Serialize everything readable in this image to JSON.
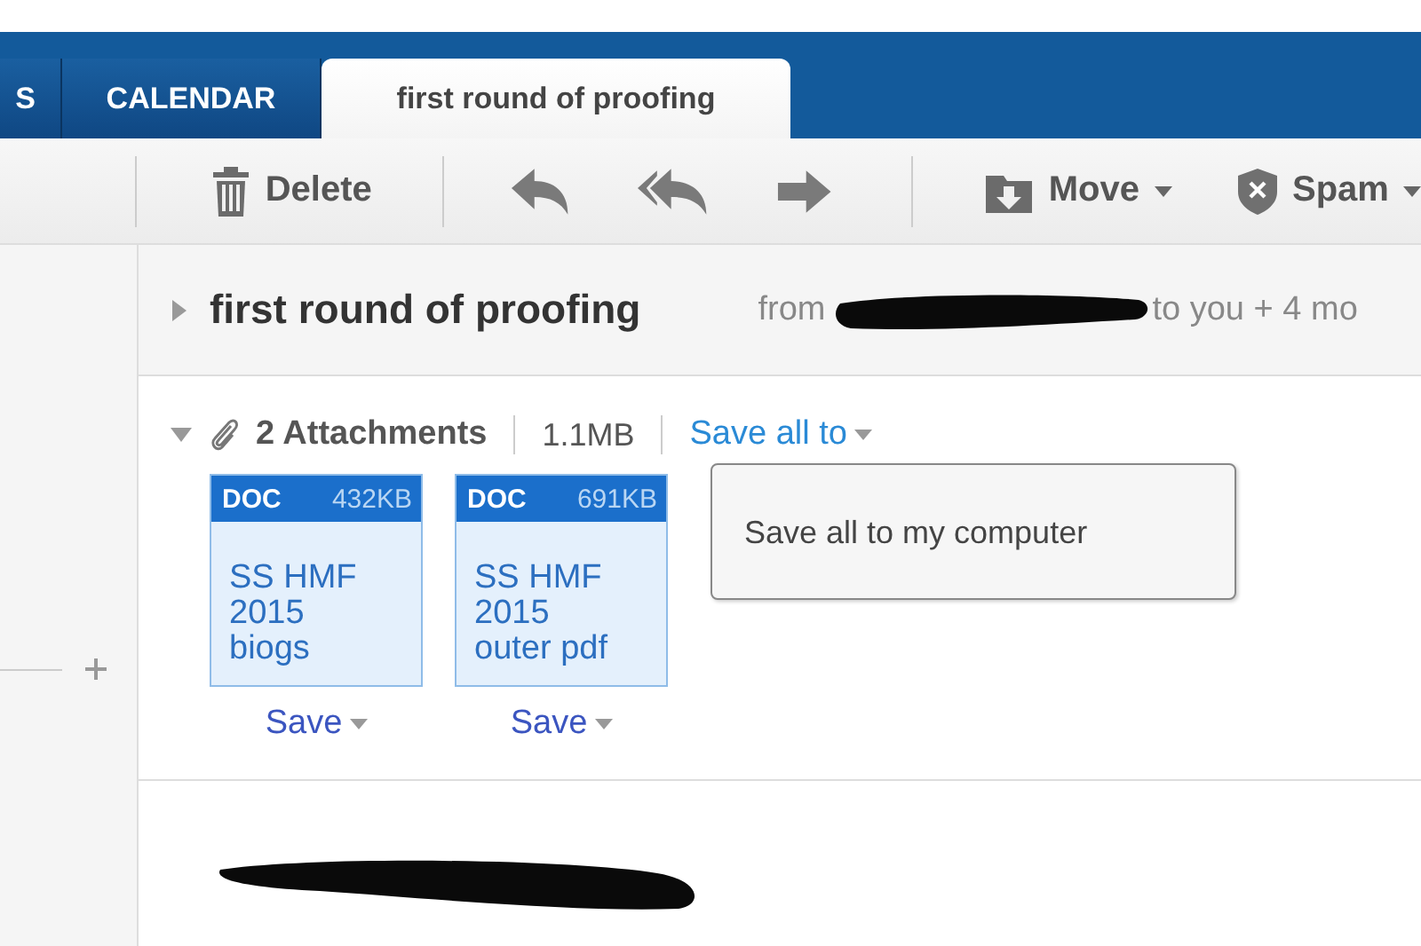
{
  "tabs": [
    {
      "label": "S",
      "selected": false
    },
    {
      "label": "CALENDAR",
      "selected": false
    },
    {
      "label": "first round of proofing",
      "selected": true
    }
  ],
  "toolbar": {
    "delete": "Delete",
    "move": "Move",
    "spam": "Spam"
  },
  "message": {
    "expanded": false,
    "subject": "first round of proofing",
    "from_label": "from",
    "recipients": "to you + 4 mo"
  },
  "attachments": {
    "expanded": true,
    "count": "2 Attachments",
    "size": "1.1MB",
    "save_all": "Save all to",
    "files": [
      {
        "type": "DOC",
        "size": "432KB",
        "name": "SS HMF 2015 biogs",
        "save": "Save"
      },
      {
        "type": "DOC",
        "size": "691KB",
        "name": "SS HMF 2015 outer pdf",
        "save": "Save"
      }
    ]
  },
  "menu": {
    "items": [
      "Save all to my computer"
    ]
  }
}
